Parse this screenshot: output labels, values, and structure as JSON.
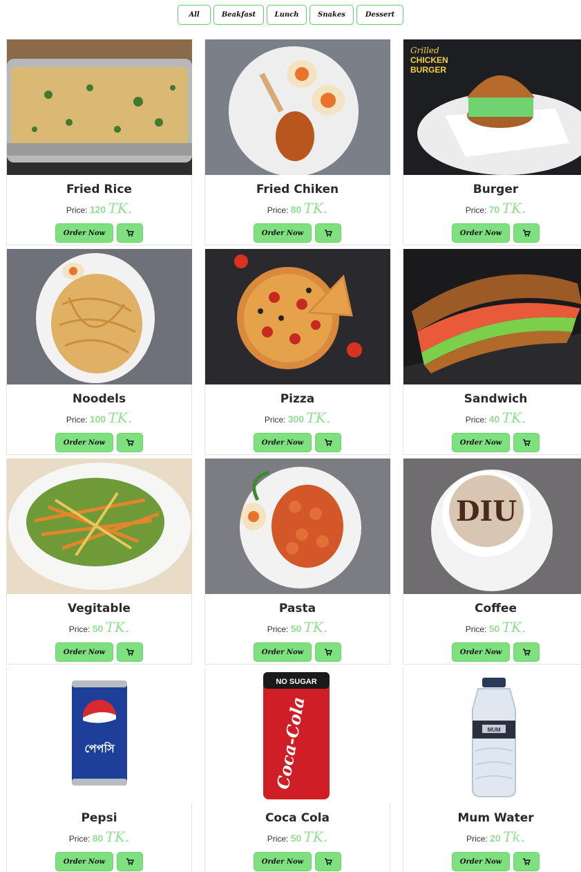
{
  "filters": [
    "All",
    "Beakfast",
    "Lunch",
    "Snakes",
    "Dessert"
  ],
  "labels": {
    "price": "Price:",
    "order": "Order Now"
  },
  "icons": {
    "cart": "cart-icon"
  },
  "colors": {
    "accent": "#7ee07e",
    "price": "#8fe08f",
    "border": "#5fd36a"
  },
  "items": [
    {
      "name": "Fried Rice",
      "price": "120",
      "currency": "TK."
    },
    {
      "name": "Fried Chiken",
      "price": "80",
      "currency": "TK."
    },
    {
      "name": "Burger",
      "price": "70",
      "currency": "TK."
    },
    {
      "name": "Noodels",
      "price": "100",
      "currency": "TK."
    },
    {
      "name": "Pizza",
      "price": "300",
      "currency": "TK."
    },
    {
      "name": "Sandwich",
      "price": "40",
      "currency": "TK."
    },
    {
      "name": "Vegitable",
      "price": "50",
      "currency": "TK."
    },
    {
      "name": "Pasta",
      "price": "50",
      "currency": "TK."
    },
    {
      "name": "Coffee",
      "price": "50",
      "currency": "TK."
    },
    {
      "name": "Pepsi",
      "price": "80",
      "currency": "TK."
    },
    {
      "name": "Coca Cola",
      "price": "50",
      "currency": "TK."
    },
    {
      "name": "Mum Water",
      "price": "20",
      "currency": "Tk."
    }
  ],
  "photo_text": {
    "burger_l1": "Grilled",
    "burger_l2": "CHICKEN",
    "burger_l3": "BURGER",
    "coffee_art": "DIU",
    "coke_top": "NO SUGAR",
    "coke_logo": "Coca-Cola",
    "pepsi_bn": "পেপসি",
    "water_label": "MUM"
  }
}
